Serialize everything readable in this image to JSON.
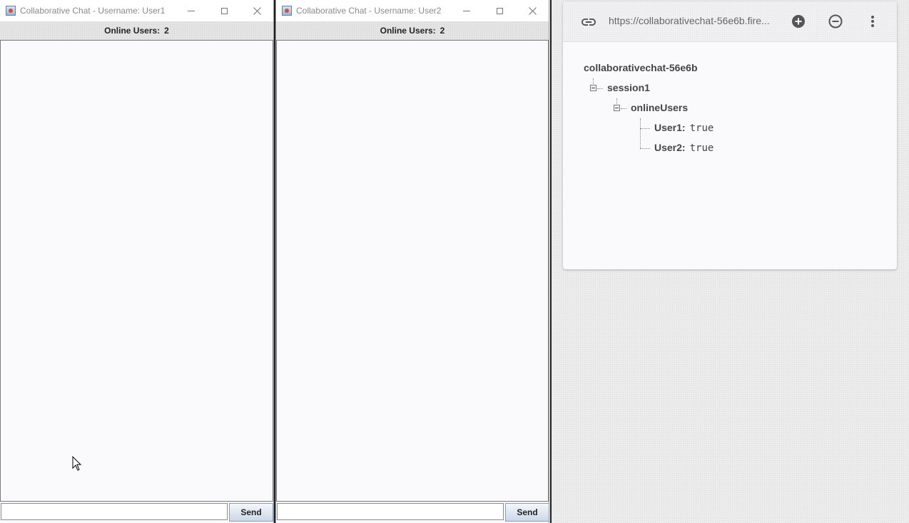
{
  "windows": [
    {
      "title": "Collaborative Chat - Username: User1",
      "online_label": "Online Users:",
      "online_count": "2",
      "message_input": "",
      "send_label": "Send"
    },
    {
      "title": "Collaborative Chat - Username: User2",
      "online_label": "Online Users:",
      "online_count": "2",
      "message_input": "",
      "send_label": "Send"
    }
  ],
  "firebase": {
    "url": "https://collaborativechat-56e6b.fire...",
    "root": "collaborativechat-56e6b",
    "session": "session1",
    "group": "onlineUsers",
    "entries": [
      {
        "key": "User1:",
        "value": "true"
      },
      {
        "key": "User2:",
        "value": "true"
      }
    ]
  },
  "icons": {
    "app": "java-app-icon",
    "minimize": "minimize-icon",
    "maximize": "maximize-icon",
    "close": "close-icon",
    "link": "link-icon",
    "add": "add-circle-icon",
    "remove": "remove-circle-icon",
    "more": "more-vert-icon"
  }
}
